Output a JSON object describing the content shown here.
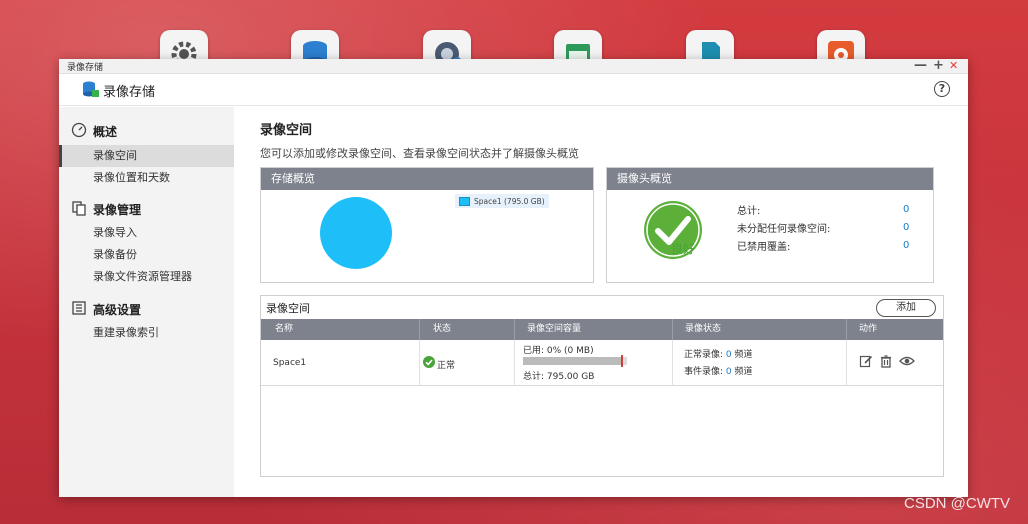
{
  "desktop_icons": [
    {
      "name": "settings-app-icon",
      "color": "#555555"
    },
    {
      "name": "storage-app-icon",
      "color": "#2d7fd0"
    },
    {
      "name": "hybrid-backup-app-icon",
      "color": "#4a5a70"
    },
    {
      "name": "calendar-app-icon",
      "color": "#2e9a5a"
    },
    {
      "name": "file-app-icon",
      "color": "#1e8fb0"
    },
    {
      "name": "surveillance-app-icon",
      "color": "#e85b2a"
    }
  ],
  "window": {
    "titlebar_title": "录像存储",
    "app_title": "录像存储",
    "help_label": "?",
    "controls": {
      "minimize": "—",
      "maximize": "+",
      "close": "✕"
    }
  },
  "sidebar": {
    "sections": [
      {
        "label": "概述",
        "icon": "gauge-icon",
        "items": [
          {
            "label": "录像空间",
            "active": true
          },
          {
            "label": "录像位置和天数",
            "active": false
          }
        ]
      },
      {
        "label": "录像管理",
        "icon": "copy-icon",
        "items": [
          {
            "label": "录像导入",
            "active": false
          },
          {
            "label": "录像备份",
            "active": false
          },
          {
            "label": "录像文件资源管理器",
            "active": false
          }
        ]
      },
      {
        "label": "高级设置",
        "icon": "sliders-icon",
        "items": [
          {
            "label": "重建录像索引",
            "active": false
          }
        ]
      }
    ]
  },
  "main": {
    "title": "录像空间",
    "description": "您可以添加或修改录像空间、查看录像空间状态并了解摄像头概览",
    "storage_overview": {
      "heading": "存储概览",
      "legend": "Space1 (795.0 GB)"
    },
    "camera_overview": {
      "heading": "摄像头概览",
      "status": "良好",
      "rows": [
        {
          "label": "总计:",
          "value": "0"
        },
        {
          "label": "未分配任何录像空间:",
          "value": "0"
        },
        {
          "label": "已禁用覆盖:",
          "value": "0"
        }
      ]
    },
    "volume_list": {
      "heading": "录像空间",
      "add_label": "添加",
      "columns": [
        "名称",
        "状态",
        "录像空间容量",
        "录像状态",
        "动作"
      ],
      "rows": [
        {
          "name": "Space1",
          "status": "正常",
          "used": "已用: 0% (0 MB)",
          "used_fraction": 0.95,
          "total": "总计: 795.00 GB",
          "normal_rec_prefix": "正常录像:",
          "normal_rec_count": "0",
          "normal_rec_unit": "频道",
          "event_rec_prefix": "事件录像:",
          "event_rec_count": "0",
          "event_rec_unit": "频道"
        }
      ]
    }
  },
  "chart_data": {
    "type": "pie",
    "categories": [
      "Space1 (795.0 GB)"
    ],
    "values": [
      795.0
    ],
    "colors": [
      "#1ebef8"
    ],
    "legend": "top-right"
  },
  "watermark": "CSDN @CWTV",
  "colors": {
    "accent_blue": "#1ebef8",
    "header_gray": "#7e828d",
    "ok_green": "#4aa33a",
    "link_blue": "#1a7ec8"
  }
}
